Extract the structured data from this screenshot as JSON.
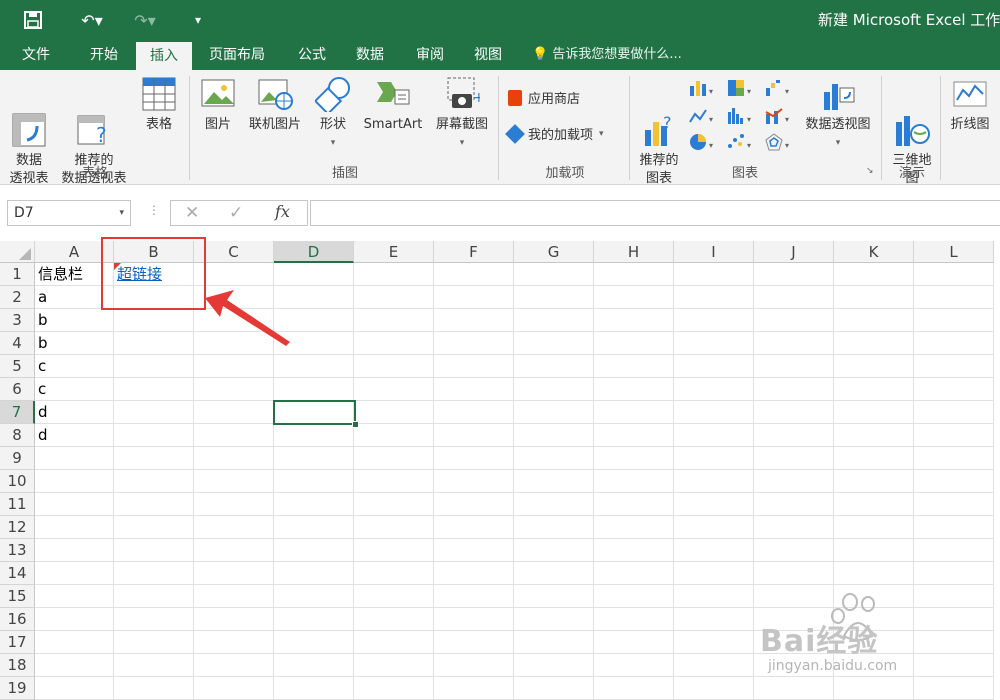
{
  "window": {
    "title": "新建 Microsoft Excel 工作表"
  },
  "ribbon_tabs": [
    "文件",
    "开始",
    "插入",
    "页面布局",
    "公式",
    "数据",
    "审阅",
    "视图"
  ],
  "active_tab": "插入",
  "tell_me": "告诉我您想要做什么...",
  "ribbon": {
    "pivot_table": "数据\n透视表",
    "recommended_pivot": "推荐的\n数据透视表",
    "table": "表格",
    "group_tables": "表格",
    "picture": "图片",
    "online_picture": "联机图片",
    "shapes": "形状",
    "smartart": "SmartArt",
    "screenshot": "屏幕截图",
    "group_illustrations": "插图",
    "store": "应用商店",
    "my_addins": "我的加载项",
    "group_addins": "加载项",
    "recommended_charts": "推荐的\n图表",
    "pivot_chart": "数据透视图",
    "group_charts": "图表",
    "map_3d": "三维地\n图",
    "group_tours": "演示",
    "line_sparkline": "折线图"
  },
  "formula_bar": {
    "name_box": "D7",
    "formula": ""
  },
  "columns": [
    "A",
    "B",
    "C",
    "D",
    "E",
    "F",
    "G",
    "H",
    "I",
    "J",
    "K",
    "L"
  ],
  "selected_column": "D",
  "rows": [
    "1",
    "2",
    "3",
    "4",
    "5",
    "6",
    "7",
    "8",
    "9",
    "10",
    "11",
    "12",
    "13",
    "14",
    "15",
    "16",
    "17",
    "18",
    "19"
  ],
  "selected_row": "7",
  "cells": {
    "A1": "信息栏",
    "B1": "超链接",
    "A2": "a",
    "A3": "b",
    "A4": "b",
    "A5": "c",
    "A6": "c",
    "A7": "d",
    "A8": "d"
  },
  "watermark": {
    "brand": "Bai经验",
    "url": "jingyan.baidu.com"
  },
  "colors": {
    "brand": "#217346",
    "annotation": "#e53935",
    "link": "#0563c1"
  }
}
